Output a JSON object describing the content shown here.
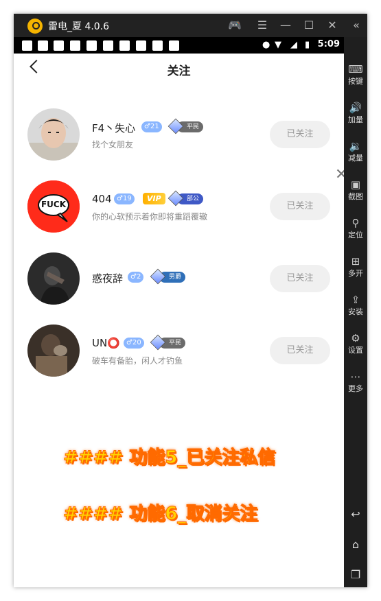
{
  "emulator": {
    "title": "雷电_夏 4.0.6",
    "status_time": "5:09",
    "sidebar": [
      {
        "label": "按键",
        "icon": "keyboard-icon"
      },
      {
        "label": "加量",
        "icon": "volume-up-icon"
      },
      {
        "label": "减量",
        "icon": "volume-down-icon"
      },
      {
        "label": "截图",
        "icon": "screenshot-icon"
      },
      {
        "label": "定位",
        "icon": "location-icon"
      },
      {
        "label": "多开",
        "icon": "multi-open-icon"
      },
      {
        "label": "安装",
        "icon": "install-icon"
      },
      {
        "label": "设置",
        "icon": "settings-icon"
      },
      {
        "label": "更多",
        "icon": "more-icon"
      }
    ]
  },
  "page": {
    "title": "关注"
  },
  "follows": [
    {
      "name": "F4丶失心",
      "gender": "♂21",
      "rank": "平民",
      "vip": "",
      "bio": "找个女朋友",
      "button": "已关注"
    },
    {
      "name": "404",
      "gender": "♂19",
      "rank": "部公",
      "vip": "VIP",
      "bio": "你的心软预示着你即将重蹈覆辙",
      "button": "已关注"
    },
    {
      "name": "惑夜辞",
      "gender": "♂2",
      "rank": "男爵",
      "vip": "",
      "bio": "",
      "button": "已关注"
    },
    {
      "name": "UN⭕",
      "gender": "♂20",
      "rank": "平民",
      "vip": "",
      "bio": "破车有备胎，闲人才钓鱼",
      "button": "已关注"
    }
  ],
  "avatar_texts": {
    "fuck": "FUCK"
  },
  "overlay": {
    "line1": "#### 功能5_已关注私信",
    "line2": "#### 功能6_取消关注"
  },
  "colors": {
    "gender_badge": "#8ab6ff",
    "rank_commoner": "#6b6b6b",
    "rank_duke": "#3f59c6",
    "rank_baron": "#2f6fb8",
    "vip": "#ffb000",
    "overlay_text": "#ffd400"
  }
}
